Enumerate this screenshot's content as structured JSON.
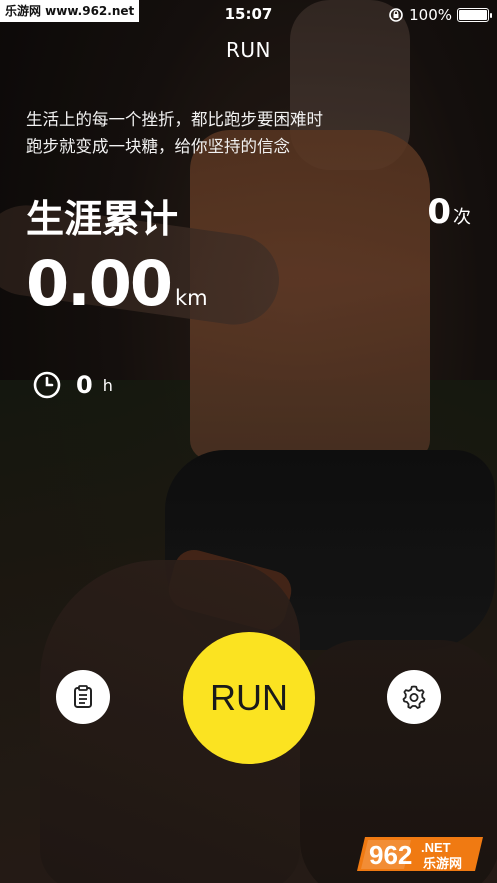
{
  "watermark": "乐游网 www.962.net",
  "status_bar": {
    "time": "15:07",
    "battery": "100%"
  },
  "nav": {
    "title": "RUN"
  },
  "motto": {
    "line1": "生活上的每一个挫折，都比跑步要困难时",
    "line2": "跑步就变成一块糖，给你坚持的信念"
  },
  "stats": {
    "career_label": "生涯累计",
    "run_count": "0",
    "run_count_unit": "次",
    "distance": "0.00",
    "distance_unit": "km",
    "duration": "0",
    "duration_unit": "h"
  },
  "actions": {
    "run_label": "RUN"
  },
  "logo": {
    "text": "962",
    "subtext": ".NET",
    "subtitle": "乐游网"
  },
  "colors": {
    "accent": "#fbe321",
    "text": "#ffffff"
  },
  "icons": {
    "duration": "clock-icon",
    "records": "clipboard-icon",
    "settings": "gear-icon",
    "rotation": "rotation-lock-icon"
  }
}
